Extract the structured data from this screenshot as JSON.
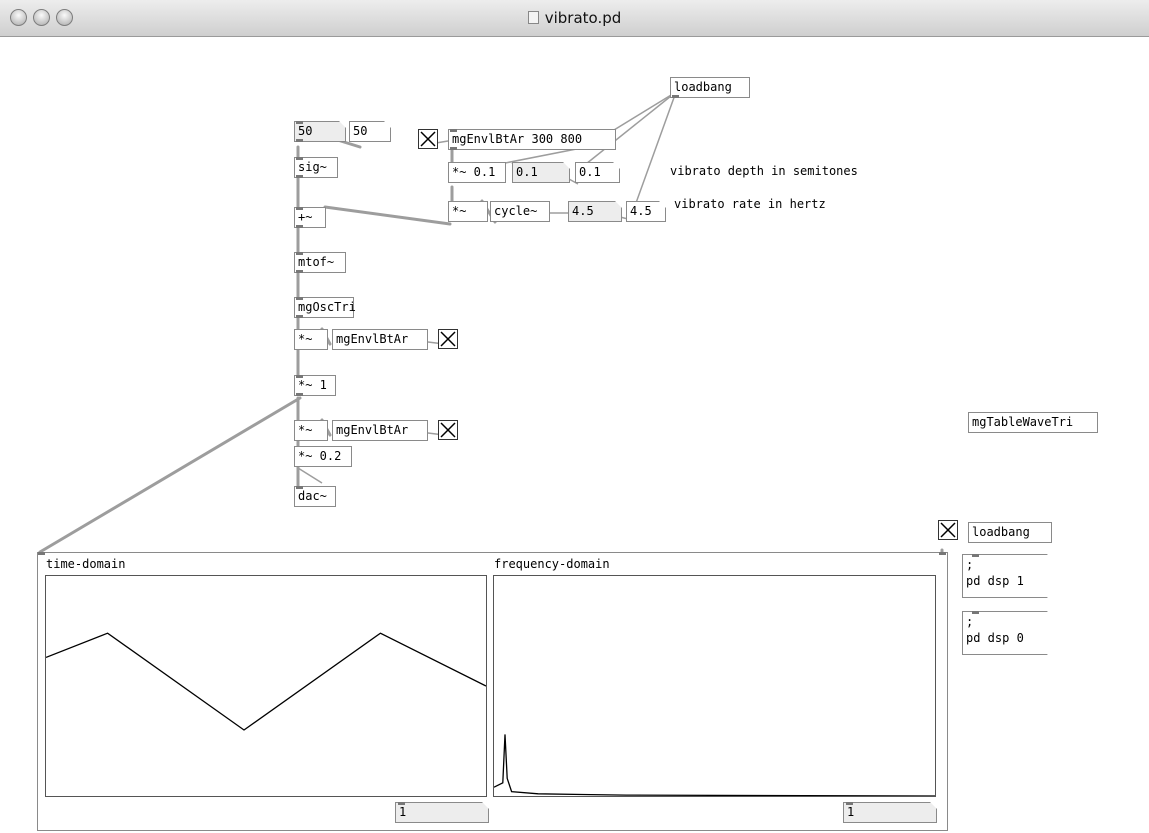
{
  "window": {
    "title": "vibrato.pd"
  },
  "objects": {
    "loadbang_top": "loadbang",
    "mgenv_top": "mgEnvlBtAr 300 800",
    "mul_01": "*~ 0.1",
    "mul_a": "*~",
    "cycle": "cycle~",
    "sig": "sig~",
    "plus": "+~",
    "mtof": "mtof~",
    "mgosctri": "mgOscTri",
    "mul_b": "*~",
    "mgenv_mid": "mgEnvlBtAr",
    "mul_1": "*~ 1",
    "mul_c": "*~",
    "mgenv_low": "mgEnvlBtAr",
    "mul_02": "*~ 0.2",
    "dac": "dac~",
    "mgtablewavetri": "mgTableWaveTri",
    "loadbang_bottom": "loadbang"
  },
  "numbers": {
    "pitch_in": "50",
    "pitch_out": "50",
    "depth_in": "0.1",
    "depth_out": "0.1",
    "rate_in": "4.5",
    "rate_out": "4.5",
    "time_zoom": "1",
    "freq_zoom": "1"
  },
  "comments": {
    "depth": "vibrato depth in semitones",
    "rate": "vibrato rate in hertz"
  },
  "messages": {
    "dsp_on": ";\npd dsp 1",
    "dsp_off": ";\npd dsp 0"
  },
  "toggles": {
    "top": true,
    "mid": true,
    "low": true,
    "dsp": true
  },
  "graph": {
    "time_label": "time-domain",
    "freq_label": "frequency-domain",
    "time_wave": [
      [
        0,
        0.63
      ],
      [
        0.14,
        0.74
      ],
      [
        0.45,
        0.3
      ],
      [
        0.76,
        0.74
      ],
      [
        1,
        0.5
      ]
    ],
    "freq_spectrum": [
      [
        0,
        0.04
      ],
      [
        0.02,
        0.06
      ],
      [
        0.025,
        0.28
      ],
      [
        0.03,
        0.08
      ],
      [
        0.04,
        0.02
      ],
      [
        0.1,
        0.01
      ],
      [
        0.2,
        0.007
      ],
      [
        0.3,
        0.004
      ],
      [
        1,
        0
      ]
    ]
  }
}
